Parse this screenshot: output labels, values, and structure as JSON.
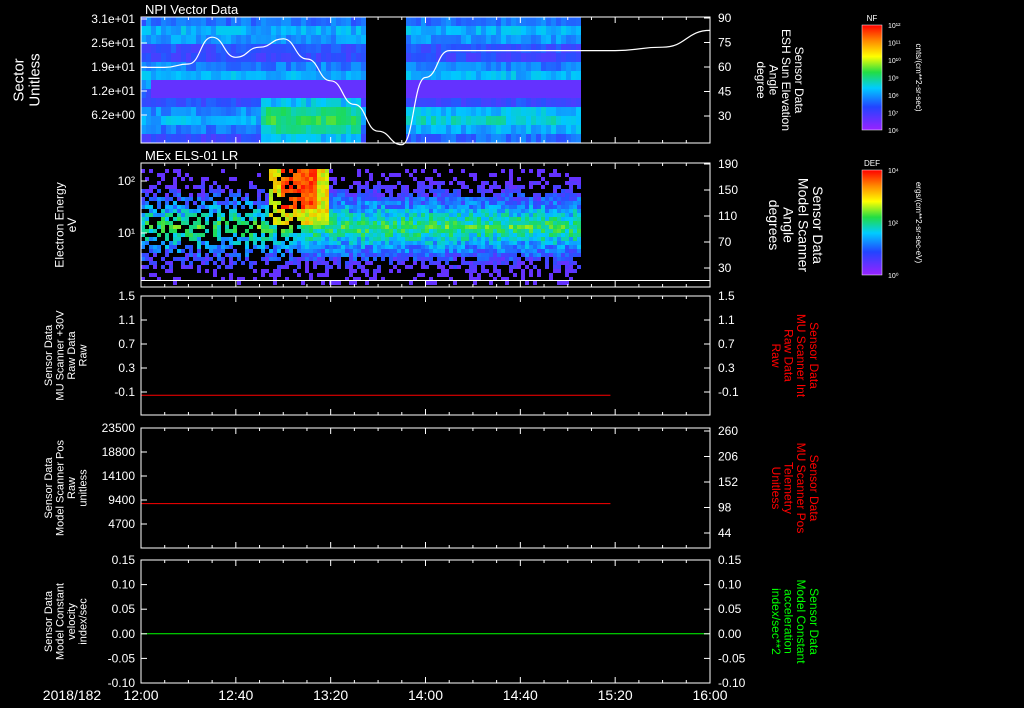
{
  "date_label": "2018/182",
  "time_ticks": [
    "12:00",
    "12:40",
    "13:20",
    "14:00",
    "14:40",
    "15:20",
    "16:00"
  ],
  "colors": {
    "red": "#ff0000",
    "green": "#00ff00",
    "white": "#ffffff",
    "spectro_high": "#ff2200",
    "spectro_mid": "#22cc44",
    "spectro_low": "#4422ff"
  },
  "colorbar1": {
    "title": "NF",
    "units": "cnts/(cm**2-sr-sec)",
    "ticks": [
      "10¹²",
      "10¹¹",
      "10¹⁰",
      "10⁹",
      "10⁸",
      "10⁷",
      "10⁶"
    ]
  },
  "colorbar2": {
    "title": "DEF",
    "units": "ergs/(cm**2-sr-sec-eV)",
    "ticks": [
      "10⁴",
      "10²",
      "10⁰"
    ]
  },
  "panels": [
    {
      "title": "NPI Vector Data",
      "left_label": [
        "Sector",
        "Unitless"
      ],
      "left_ticks": [
        "3.1e+01",
        "2.5e+01",
        "1.9e+01",
        "1.2e+01",
        "6.2e+00"
      ],
      "right_label": [
        "Sensor Data",
        "ESH Sun Elevation",
        "Angle",
        "degree"
      ],
      "right_ticks": [
        "90",
        "75",
        "60",
        "45",
        "30"
      ]
    },
    {
      "title": "MEx ELS-01 LR",
      "left_label": [
        "Electron Energy",
        "eV"
      ],
      "left_ticks": [
        "10²",
        "10¹"
      ],
      "right_label": [
        "Sensor Data",
        "Model Scanner",
        "Angle",
        "degrees"
      ],
      "right_ticks": [
        "190",
        "150",
        "110",
        "70",
        "30"
      ]
    },
    {
      "title": "",
      "left_label": [
        "Sensor Data",
        "MU Scanner +30V",
        "Raw Data",
        "Raw"
      ],
      "left_ticks": [
        "1.5",
        "1.1",
        "0.7",
        "0.3",
        "-0.1"
      ],
      "right_label": [
        "Sensor Data",
        "MU Scanner Int",
        "Raw Data",
        "Raw"
      ],
      "right_ticks": [
        "1.5",
        "1.1",
        "0.7",
        "0.3",
        "-0.1"
      ]
    },
    {
      "title": "",
      "left_label": [
        "Sensor Data",
        "Model Scanner Pos",
        "Raw",
        "unitless"
      ],
      "left_ticks": [
        "23500",
        "18800",
        "14100",
        "9400",
        "4700"
      ],
      "right_label": [
        "Sensor Data",
        "MU Scanner Pos",
        "Telemetry",
        "Unitless"
      ],
      "right_ticks": [
        "260",
        "206",
        "152",
        "98",
        "44"
      ]
    },
    {
      "title": "",
      "left_label": [
        "Sensor Data",
        "Model Constant",
        "velocity",
        "index/sec"
      ],
      "left_ticks": [
        "0.15",
        "0.10",
        "0.05",
        "0.00",
        "-0.05",
        "-0.10"
      ],
      "right_label": [
        "Sensor Data",
        "Model Constant",
        "acceleration",
        "index/sec**2"
      ],
      "right_ticks": [
        "0.15",
        "0.10",
        "0.05",
        "0.00",
        "-0.05",
        "-0.10"
      ]
    }
  ],
  "chart_data": [
    {
      "type": "heatmap",
      "title": "NPI Vector Data",
      "xlabel": "",
      "ylabel": "Sector Unitless",
      "xlim": [
        "12:00",
        "16:00"
      ],
      "ylim": [
        0,
        31
      ],
      "note_gap": [
        "13:35",
        "13:50"
      ],
      "data_end": "15:05",
      "overlay_series": {
        "name": "",
        "y_axis": "right",
        "ylim": [
          15,
          90
        ],
        "x": [
          "12:00",
          "12:10",
          "12:20",
          "12:30",
          "12:40",
          "12:50",
          "13:00",
          "13:10",
          "13:20",
          "13:30",
          "13:40",
          "13:50",
          "14:00",
          "14:10",
          "14:20",
          "14:40",
          "15:00",
          "15:20",
          "15:40",
          "16:00"
        ],
        "values": [
          60,
          60,
          62,
          78,
          66,
          72,
          77,
          65,
          52,
          38,
          22,
          14,
          54,
          70,
          70,
          70,
          70,
          70,
          72,
          82
        ]
      }
    },
    {
      "type": "heatmap",
      "title": "MEx ELS-01 LR",
      "xlabel": "",
      "ylabel": "Electron Energy eV",
      "yscale": "log",
      "xlim": [
        "12:00",
        "15:05"
      ],
      "peak_time": "13:05",
      "peak_energy_eV": 100,
      "overlay_series": {
        "name": "",
        "y_axis": "right",
        "ylim": [
          0,
          190
        ],
        "x": [
          "12:00",
          "16:00"
        ],
        "values": [
          10,
          10
        ]
      }
    },
    {
      "type": "line",
      "title": "",
      "ylim": [
        -0.3,
        1.5
      ],
      "series": [
        {
          "name": "",
          "x": [
            "12:00",
            "15:18"
          ],
          "values": [
            0.0,
            0.0
          ]
        }
      ]
    },
    {
      "type": "line",
      "title": "",
      "ylim": [
        0,
        23500
      ],
      "series": [
        {
          "name": "",
          "x": [
            "12:00",
            "15:18"
          ],
          "values": [
            8700,
            8700
          ]
        }
      ]
    },
    {
      "type": "line",
      "title": "",
      "ylim": [
        -0.1,
        0.15
      ],
      "series": [
        {
          "name": "",
          "x": [
            "12:00",
            "16:00"
          ],
          "values": [
            0.0,
            0.0
          ]
        }
      ]
    }
  ]
}
